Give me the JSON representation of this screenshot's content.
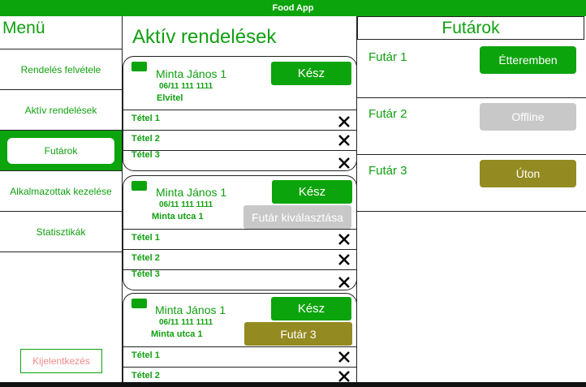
{
  "app": {
    "title": "Food App"
  },
  "sidebar": {
    "title": "Menü",
    "items": [
      {
        "label": "Rendelés felvétele",
        "active": false
      },
      {
        "label": "Aktív rendelések",
        "active": false
      },
      {
        "label": "Futárok",
        "active": true
      },
      {
        "label": "Alkalmazottak kezelése",
        "active": false
      },
      {
        "label": "Statisztikák",
        "active": false
      }
    ],
    "logout_label": "Kijelentkezés"
  },
  "orders": {
    "title": "Aktív rendelések",
    "list": [
      {
        "customer": "Minta János 1",
        "phone": "06/11 111 1111",
        "extra": "Elvitel",
        "done_label": "Kész",
        "courier_button": null,
        "items": [
          "Tétel 1",
          "Tétel 2",
          "Tétel 3"
        ]
      },
      {
        "customer": "Minta János 1",
        "phone": "06/11 111 1111",
        "extra": "Minta utca 1",
        "done_label": "Kész",
        "courier_button": {
          "label": "Futár kiválasztása",
          "state": "unassigned"
        },
        "items": [
          "Tétel 1",
          "Tétel 2",
          "Tétel 3"
        ]
      },
      {
        "customer": "Minta János 1",
        "phone": "06/11 111 1111",
        "extra": "Minta utca 1",
        "done_label": "Kész",
        "courier_button": {
          "label": "Futár 3",
          "state": "assigned"
        },
        "items": [
          "Tétel 1",
          "Tétel 2"
        ]
      }
    ]
  },
  "couriers": {
    "title": "Futárok",
    "list": [
      {
        "name": "Futár 1",
        "status": "Étteremben",
        "status_color": "#0ca40c"
      },
      {
        "name": "Futár 2",
        "status": "Offline",
        "status_color": "#c8c8c8"
      },
      {
        "name": "Futár 3",
        "status": "Úton",
        "status_color": "#948a22"
      }
    ]
  },
  "colors": {
    "accent": "#0ca40c",
    "text_green": "#11a011",
    "assigned": "#948a22",
    "disabled": "#c8c8c8",
    "logout_text": "#f08a8a"
  }
}
